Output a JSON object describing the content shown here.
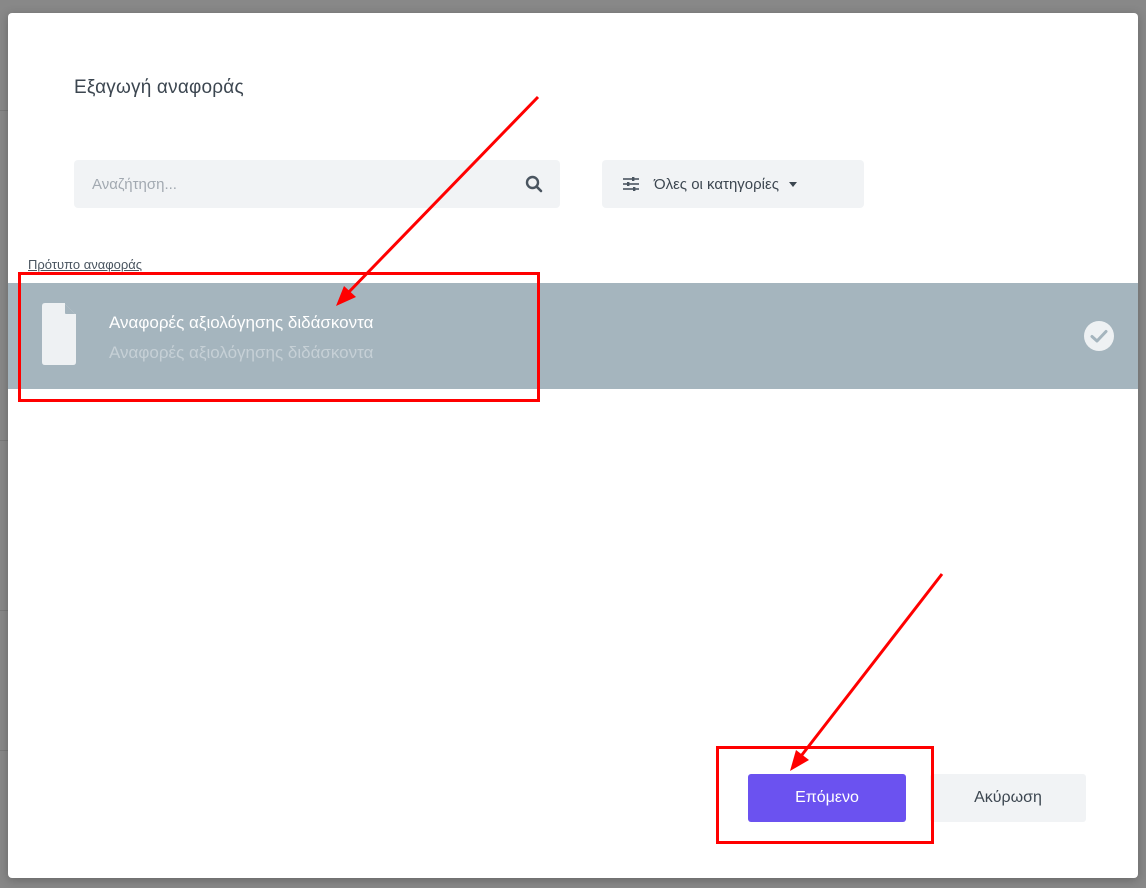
{
  "dialog": {
    "title": "Εξαγωγή αναφοράς"
  },
  "search": {
    "placeholder": "Αναζήτηση...",
    "value": ""
  },
  "category_filter": {
    "label": "Όλες οι κατηγορίες"
  },
  "section": {
    "label": "Πρότυπο αναφοράς"
  },
  "templates": [
    {
      "title": "Αναφορές αξιολόγησης διδάσκοντα",
      "subtitle": "Αναφορές αξιολόγησης διδάσκοντα",
      "selected": true
    }
  ],
  "actions": {
    "next_label": "Επόμενο",
    "cancel_label": "Ακύρωση"
  },
  "colors": {
    "primary": "#6b52f0",
    "selected_row": "#a5b5be",
    "annotation": "#ff0000",
    "input_bg": "#f1f3f5"
  }
}
